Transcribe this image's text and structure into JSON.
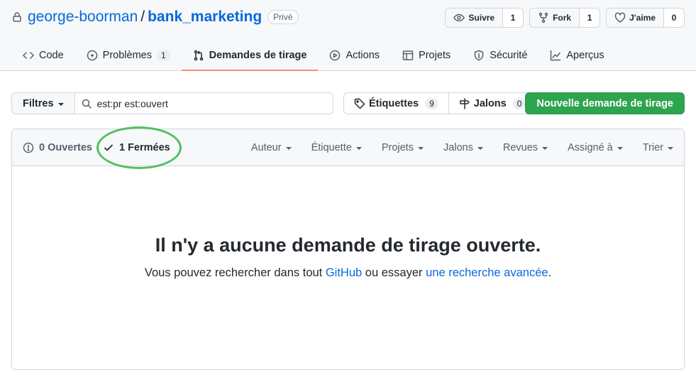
{
  "repo": {
    "owner": "george-boorman",
    "separator": "/",
    "name": "bank_marketing",
    "visibility": "Privé"
  },
  "repo_actions": {
    "watch": {
      "label": "Suivre",
      "count": "1",
      "icon": "eye-icon"
    },
    "fork": {
      "label": "Fork",
      "count": "1",
      "icon": "fork-icon"
    },
    "star": {
      "label": "J'aime",
      "count": "0",
      "icon": "heart-icon"
    }
  },
  "tabs": [
    {
      "label": "Code",
      "icon": "code-icon"
    },
    {
      "label": "Problèmes",
      "counter": "1",
      "icon": "issue-icon"
    },
    {
      "label": "Demandes de tirage",
      "icon": "pull-request-icon",
      "selected": true
    },
    {
      "label": "Actions",
      "icon": "play-icon"
    },
    {
      "label": "Projets",
      "icon": "table-icon"
    },
    {
      "label": "Sécurité",
      "icon": "shield-icon"
    },
    {
      "label": "Aperçus",
      "icon": "graph-icon"
    }
  ],
  "subnav": {
    "filters_label": "Filtres",
    "search_value": "est:pr est:ouvert",
    "labels": {
      "label": "Étiquettes",
      "count": "9"
    },
    "milestones": {
      "label": "Jalons",
      "count": "0"
    },
    "new_pr_label": "Nouvelle demande de tirage"
  },
  "list_header": {
    "open_label": "0 Ouvertes",
    "closed_label": "1 Fermées",
    "sorts": [
      "Auteur",
      "Étiquette",
      "Projets",
      "Jalons",
      "Revues",
      "Assigné à",
      "Trier"
    ]
  },
  "blankslate": {
    "title": "Il n'y a aucune demande de tirage ouverte.",
    "text_before": "Vous pouvez rechercher dans tout ",
    "link1": "GitHub",
    "text_middle": " ou essayer ",
    "link2": "une recherche avancée",
    "text_after": "."
  },
  "colors": {
    "link": "#0969da",
    "primary_button": "#2da44e",
    "tab_underline": "#fd8c73",
    "highlight_circle": "#3fb950"
  }
}
